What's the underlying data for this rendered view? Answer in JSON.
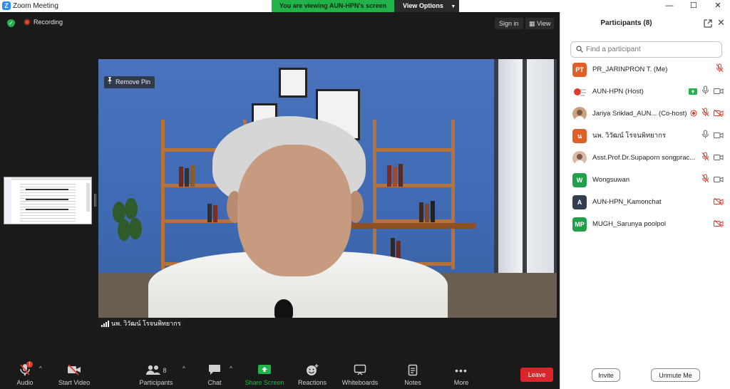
{
  "window": {
    "title": "Zoom Meeting",
    "logo_letter": "Z",
    "controls": [
      "—",
      "☐",
      "✕"
    ]
  },
  "share_banner": {
    "viewing_text": "You are viewing AUN-HPN's screen",
    "view_options_label": "View Options"
  },
  "meeting": {
    "recording_label": "Recording",
    "sign_in_label": "Sign in",
    "view_label": "View",
    "remove_pin_label": "Remove Pin",
    "speaker_name": "นพ. วิวัฒน์ โรจนพิทยากร"
  },
  "toolbar": {
    "audio": "Audio",
    "audio_badge": "!",
    "start_video": "Start Video",
    "participants": "Participants",
    "participants_count": "8",
    "chat": "Chat",
    "share_screen": "Share Screen",
    "reactions": "Reactions",
    "whiteboards": "Whiteboards",
    "notes": "Notes",
    "more": "More",
    "leave": "Leave"
  },
  "participants_panel": {
    "title": "Participants (8)",
    "search_placeholder": "Find a participant",
    "invite_label": "Invite",
    "unmute_label": "Unmute Me",
    "participants": [
      {
        "initials": "PT",
        "name": "PR_JARINPRON T. (Me)",
        "avatar_color": "#e0602a",
        "mic": "muted",
        "video": "none",
        "sharing": false,
        "recording": false
      },
      {
        "initials": "",
        "name": "AUN-HPN (Host)",
        "avatar_color": "#ffffff",
        "mic": "on",
        "video": "off-gray",
        "sharing": true,
        "recording": false
      },
      {
        "initials": "",
        "name": "Jariya Sriklad_AUN... (Co-host)",
        "avatar_color": "#c9a27e",
        "mic": "muted",
        "video": "muted",
        "sharing": false,
        "recording": true
      },
      {
        "initials": "น",
        "name": "นพ. วิวัฒน์ โรจนพิทยากร",
        "avatar_color": "#e0602a",
        "mic": "on",
        "video": "off-gray",
        "sharing": false,
        "recording": false
      },
      {
        "initials": "",
        "name": "Asst.Prof.Dr.Supaporn songprac...",
        "avatar_color": "#d9b8a8",
        "mic": "muted",
        "video": "off-gray",
        "sharing": false,
        "recording": false
      },
      {
        "initials": "W",
        "name": "Wongsuwan",
        "avatar_color": "#22a049",
        "mic": "muted",
        "video": "off-gray",
        "sharing": false,
        "recording": false
      },
      {
        "initials": "A",
        "name": "AUN-HPN_Kamonchat",
        "avatar_color": "#333d4f",
        "mic": "none",
        "video": "muted",
        "sharing": false,
        "recording": false
      },
      {
        "initials": "MP",
        "name": "MUGH_Sarunya poolpol",
        "avatar_color": "#22a049",
        "mic": "none",
        "video": "muted",
        "sharing": false,
        "recording": false
      }
    ]
  },
  "colors": {
    "accent_green": "#22b24a",
    "leave_red": "#d9252b",
    "muted_red": "#e03b2b",
    "zoom_blue": "#2d8cff"
  }
}
